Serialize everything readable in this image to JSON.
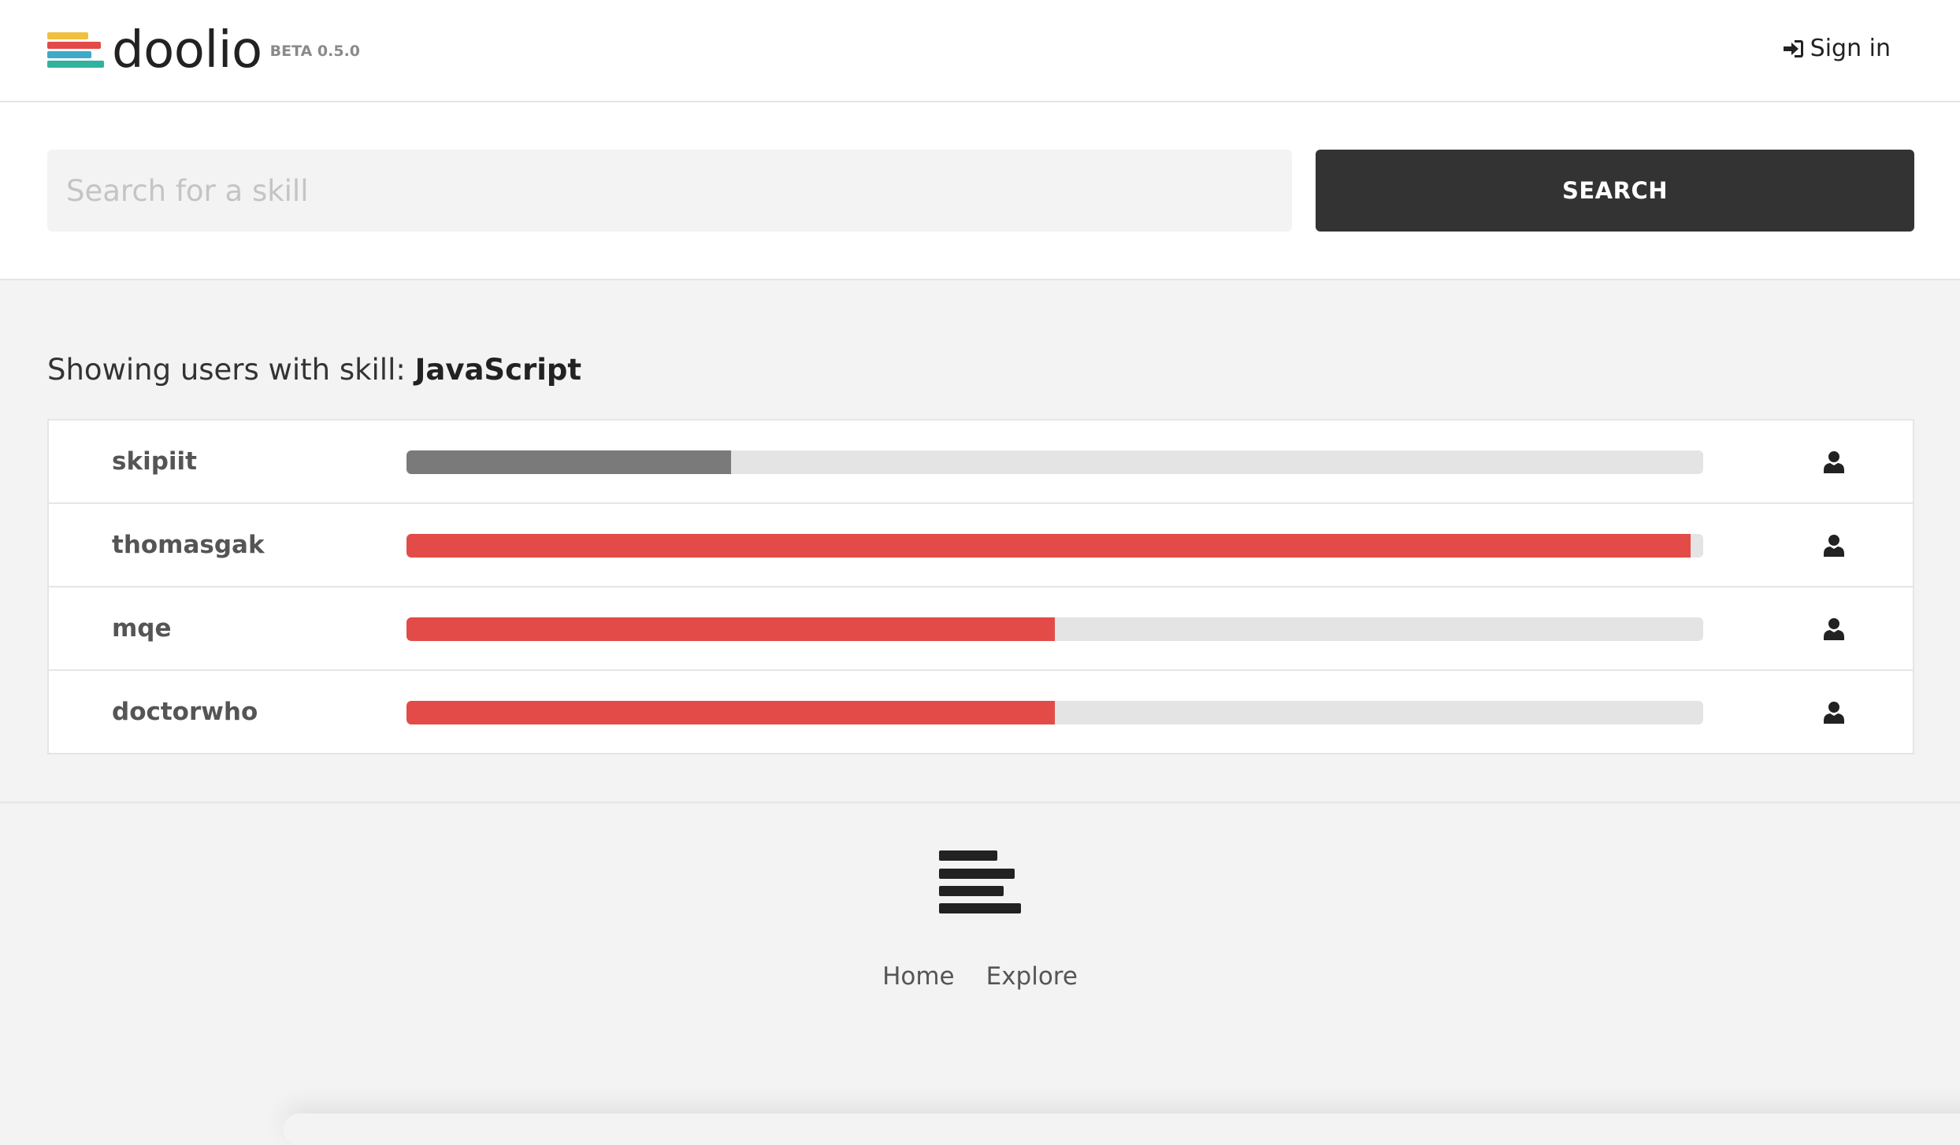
{
  "header": {
    "logo_text": "doolio",
    "beta_label": "BETA 0.5.0",
    "logo_colors": [
      "#f0c040",
      "#e24b47",
      "#3fa9c9",
      "#2fb39e"
    ],
    "signin_icon": "sign-in-icon",
    "signin_label": "Sign in"
  },
  "search": {
    "placeholder": "Search for a skill",
    "value": "",
    "button_label": "SEARCH"
  },
  "results": {
    "heading_prefix": "Showing users with skill: ",
    "skill": "JavaScript",
    "colors": {
      "track": "#e4e4e4",
      "gray_fill": "#7a7a7a",
      "red_fill": "#e24b47"
    },
    "users": [
      {
        "name": "skipiit",
        "level": 0.25,
        "fill_color": "#7a7a7a",
        "icon": "user-icon"
      },
      {
        "name": "thomasgak",
        "level": 0.99,
        "fill_color": "#e24b47",
        "icon": "user-icon"
      },
      {
        "name": "mqe",
        "level": 0.5,
        "fill_color": "#e24b47",
        "icon": "user-icon"
      },
      {
        "name": "doctorwho",
        "level": 0.5,
        "fill_color": "#e24b47",
        "icon": "user-icon"
      }
    ]
  },
  "footer": {
    "logo_icon": "doolio-logo-icon",
    "links": [
      "Home",
      "Explore"
    ]
  }
}
